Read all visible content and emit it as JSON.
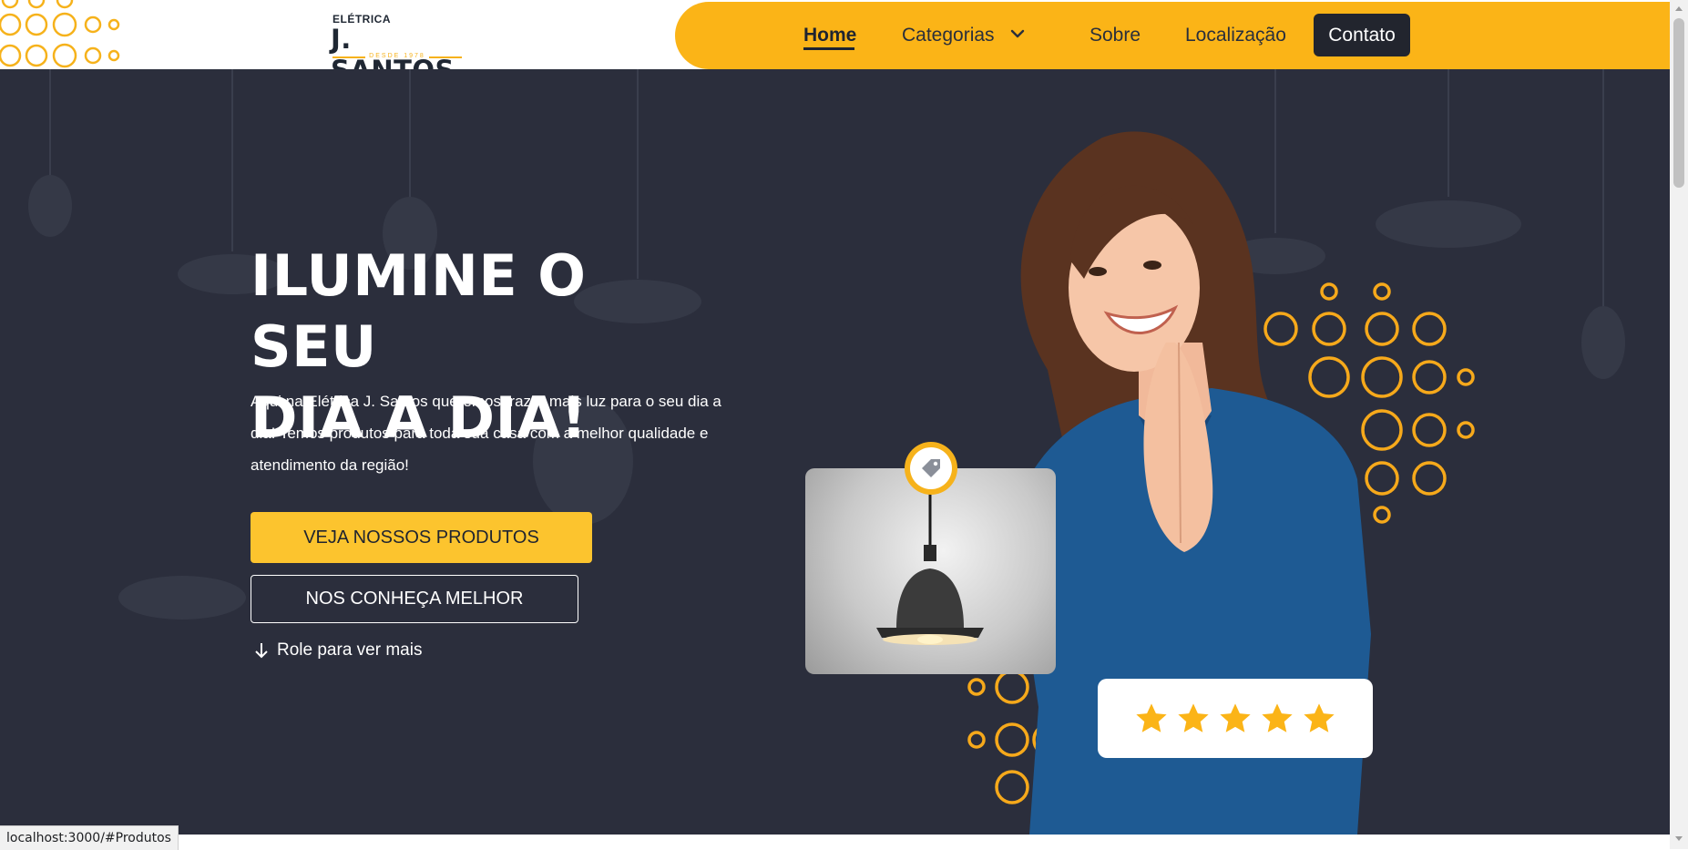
{
  "header": {
    "logo": {
      "top": "ELÉTRICA",
      "main": "J. SANTOS",
      "since": "DESDE 1978"
    },
    "nav": {
      "home": "Home",
      "categorias": "Categorias",
      "sobre": "Sobre",
      "localizacao": "Localização",
      "contato": "Contato"
    }
  },
  "hero": {
    "title_line1": "ILUMINE O SEU",
    "title_line2": "DIA A DIA!",
    "description": "Aqui na Elétrica J. Santos queremos trazer mais luz para o seu dia a dia! Temos produtos para toda sua casa com a melhor qualidade e atendimento da região!",
    "primary_button": "VEJA NOSSOS PRODUTOS",
    "secondary_button": "NOS CONHEÇA MELHOR",
    "scroll_hint": "Role para ver mais",
    "rating_stars": 5
  },
  "status_bar": {
    "url": "localhost:3000/#Produtos"
  },
  "colors": {
    "accent": "#fbb417",
    "hero_bg": "#2b2e3c",
    "dark": "#22252e"
  },
  "icons": {
    "chevron": "chevron-down-icon",
    "arrow": "arrow-down-icon",
    "tag": "price-tag-icon",
    "star": "star-icon"
  }
}
